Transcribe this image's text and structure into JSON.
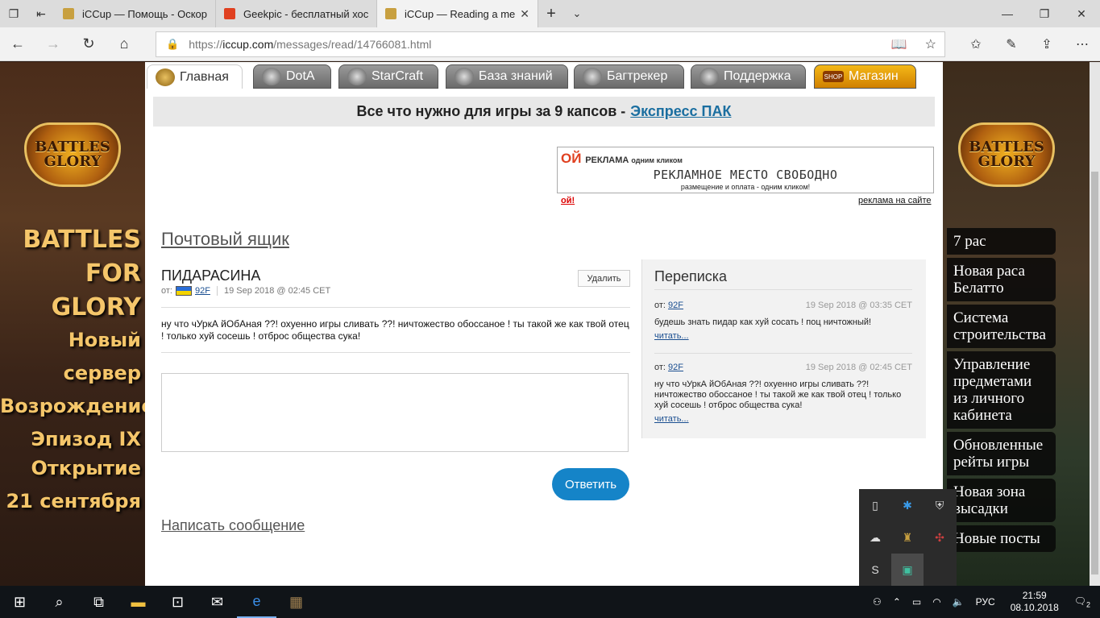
{
  "browser": {
    "tabs": [
      {
        "title": "iCCup — Помощь - Оскорб",
        "active": false
      },
      {
        "title": "Geekpic - бесплатный хост",
        "active": false
      },
      {
        "title": "iCCup — Reading a mes",
        "active": true
      }
    ],
    "url_prefix": "https://",
    "url_host": "iccup.com",
    "url_path": "/messages/read/14766081.html"
  },
  "nav": {
    "tabs": [
      "Главная",
      "DotA",
      "StarCraft",
      "База знаний",
      "Багтрекер",
      "Поддержка",
      "Магазин"
    ],
    "shop_badge": "SHOP"
  },
  "promo": {
    "text": "Все что нужно для игры за 9 капсов -",
    "link": "Экспресс ПАК"
  },
  "ad": {
    "brand": "ОЙ",
    "brand_word": "РЕКЛАМА",
    "brand_sub": "одним кликом",
    "headline": "РЕКЛАМНОЕ МЕСТО СВОБОДНО",
    "subline": "размещение и оплата - одним кликом!",
    "link_left": "ой!",
    "link_right": "реклама на сайте"
  },
  "mailbox": {
    "heading": "Почтовый ящик",
    "subject": "ПИДАРАСИНА",
    "delete_label": "Удалить",
    "from_label": "от:",
    "from_user": "92F",
    "date": "19 Sep 2018 @ 02:45 CET",
    "body": "ну что чУркА йОбАная ??! охуенно игры сливать ??! ничтожество обоссаное ! ты такой же как твой отец ! только хуй сосешь ! отброс общества сука!",
    "reply_label": "Ответить",
    "write_label": "Написать сообщение"
  },
  "thread": {
    "heading": "Переписка",
    "items": [
      {
        "from_label": "от:",
        "user": "92F",
        "date": "19 Sep 2018 @ 03:35 CET",
        "text": "будешь знать пидар как хуй сосать ! поц ничтожный!",
        "more": "читать..."
      },
      {
        "from_label": "от:",
        "user": "92F",
        "date": "19 Sep 2018 @ 02:45 CET",
        "text": "ну что чУркА йОбАная ??! охуенно игры сливать ??! ничтожество обоссаное ! ты такой же как твой отец ! только хуй сосешь ! отброс общества сука!",
        "more": "читать..."
      }
    ]
  },
  "left_banner": {
    "logo_line1": "BATTLES",
    "logo_line2": "GLORY",
    "title1": "BATTLES",
    "title2": "FOR GLORY",
    "server1": "Новый сервер",
    "server2": "Возрождение",
    "server3": "Эпизод IX",
    "open1": "Открытие",
    "open2": "21 сентября"
  },
  "right_banner": {
    "logo_line1": "BATTLES",
    "logo_line2": "GLORY",
    "items": [
      "7 рас",
      "Новая раса Белатто",
      "Система строительства",
      "Управление предметами из личного кабинета",
      "Обновленные рейты игры",
      "Новая зона высадки",
      "Новые посты"
    ]
  },
  "taskbar": {
    "lang": "РУС",
    "time": "21:59",
    "date": "08.10.2018",
    "notif_count": "2"
  }
}
